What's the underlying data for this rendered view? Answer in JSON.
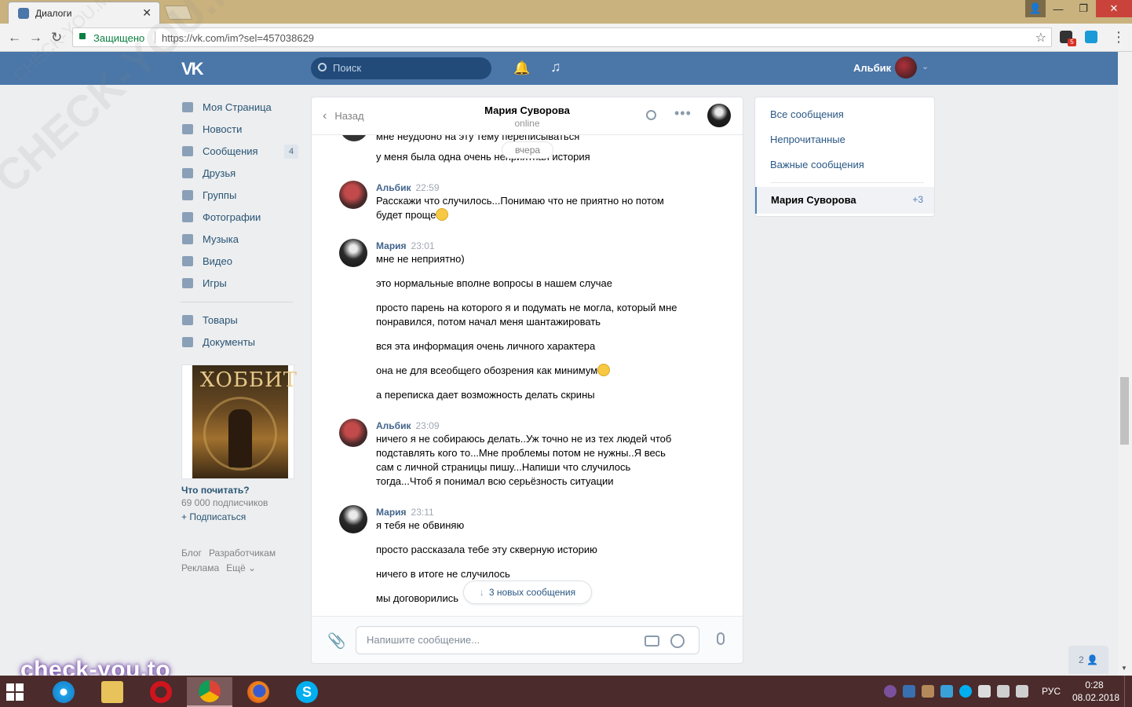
{
  "browser": {
    "tab_title": "Диалоги",
    "tab_close": "✕",
    "secure_label": "Защищено",
    "url": "https://vk.com/im?sel=457038629",
    "ext_badge": "5"
  },
  "vk": {
    "search_placeholder": "Поиск",
    "user_name": "Альбик",
    "left_menu": [
      {
        "label": "Моя Страница",
        "icon": "home-icon"
      },
      {
        "label": "Новости",
        "icon": "news-icon"
      },
      {
        "label": "Сообщения",
        "icon": "messages-icon",
        "count": "4"
      },
      {
        "label": "Друзья",
        "icon": "friends-icon"
      },
      {
        "label": "Группы",
        "icon": "groups-icon"
      },
      {
        "label": "Фотографии",
        "icon": "photos-icon"
      },
      {
        "label": "Музыка",
        "icon": "music-icon"
      },
      {
        "label": "Видео",
        "icon": "video-icon"
      },
      {
        "label": "Игры",
        "icon": "games-icon"
      },
      {
        "label": "Товары",
        "icon": "goods-icon"
      },
      {
        "label": "Документы",
        "icon": "documents-icon"
      }
    ],
    "promo": {
      "cover_title": "ХОББИТ",
      "title": "Что почитать?",
      "subscribers": "69 000 подписчиков",
      "subscribe": "+ Подписаться"
    },
    "footer_links": [
      "Блог",
      "Разработчикам",
      "Реклама",
      "Ещё ⌄"
    ]
  },
  "chat": {
    "back_label": "Назад",
    "peer_name": "Мария Суворова",
    "peer_status": "online",
    "day_divider": "вчера",
    "cut_line": "мне неудобно на эту тему переписываться",
    "first_line": "у меня была одна очень неприятная история",
    "blocks": [
      {
        "author": "Альбик",
        "time": "22:59",
        "lines": [
          "Расскажи что случилось...Понимаю что не приятно но потом будет проще"
        ]
      },
      {
        "author": "Мария",
        "time": "23:01",
        "lines": [
          "мне не неприятно)",
          "это нормальные вполне вопросы в нашем случае",
          "просто парень на которого я и подумать не могла, который мне понравился, потом начал меня шантажировать",
          "вся эта информация очень личного характера",
          "она не для всеобщего обозрения как минимум",
          "а переписка дает возможность делать скрины"
        ]
      },
      {
        "author": "Альбик",
        "time": "23:09",
        "lines": [
          "ничего я не собираюсь делать..Уж точно не из тех людей чтоб подставлять кого то...Мне проблемы потом не нужны..Я весь сам с личной страницы пишу...Напиши что случилось тогда...Чтоб я понимал всю серьёзность ситуации"
        ]
      },
      {
        "author": "Мария",
        "time": "23:11",
        "lines": [
          "я тебя не обвиняю",
          "просто рассказала тебе эту скверную историю",
          "ничего в итоге не случилось",
          "мы договорились"
        ]
      }
    ],
    "new_messages": "3 новых сообщения",
    "input_placeholder": "Напишите сообщение..."
  },
  "filters": {
    "items": [
      "Все сообщения",
      "Непрочитанные",
      "Важные сообщения"
    ],
    "active_name": "Мария Суворова",
    "active_count": "+3"
  },
  "friends_online": "2",
  "watermarks": {
    "diagonal": "CHECK-YOU.ME",
    "diagonal_small": "CHECK-YOU.ME",
    "bottom": "check-you.to"
  },
  "taskbar": {
    "lang": "РУС",
    "time": "0:28",
    "date": "08.02.2018"
  },
  "colors": {
    "vk_blue": "#4a76a8",
    "link": "#2a5885",
    "taskbar": "#4b2b2b"
  }
}
